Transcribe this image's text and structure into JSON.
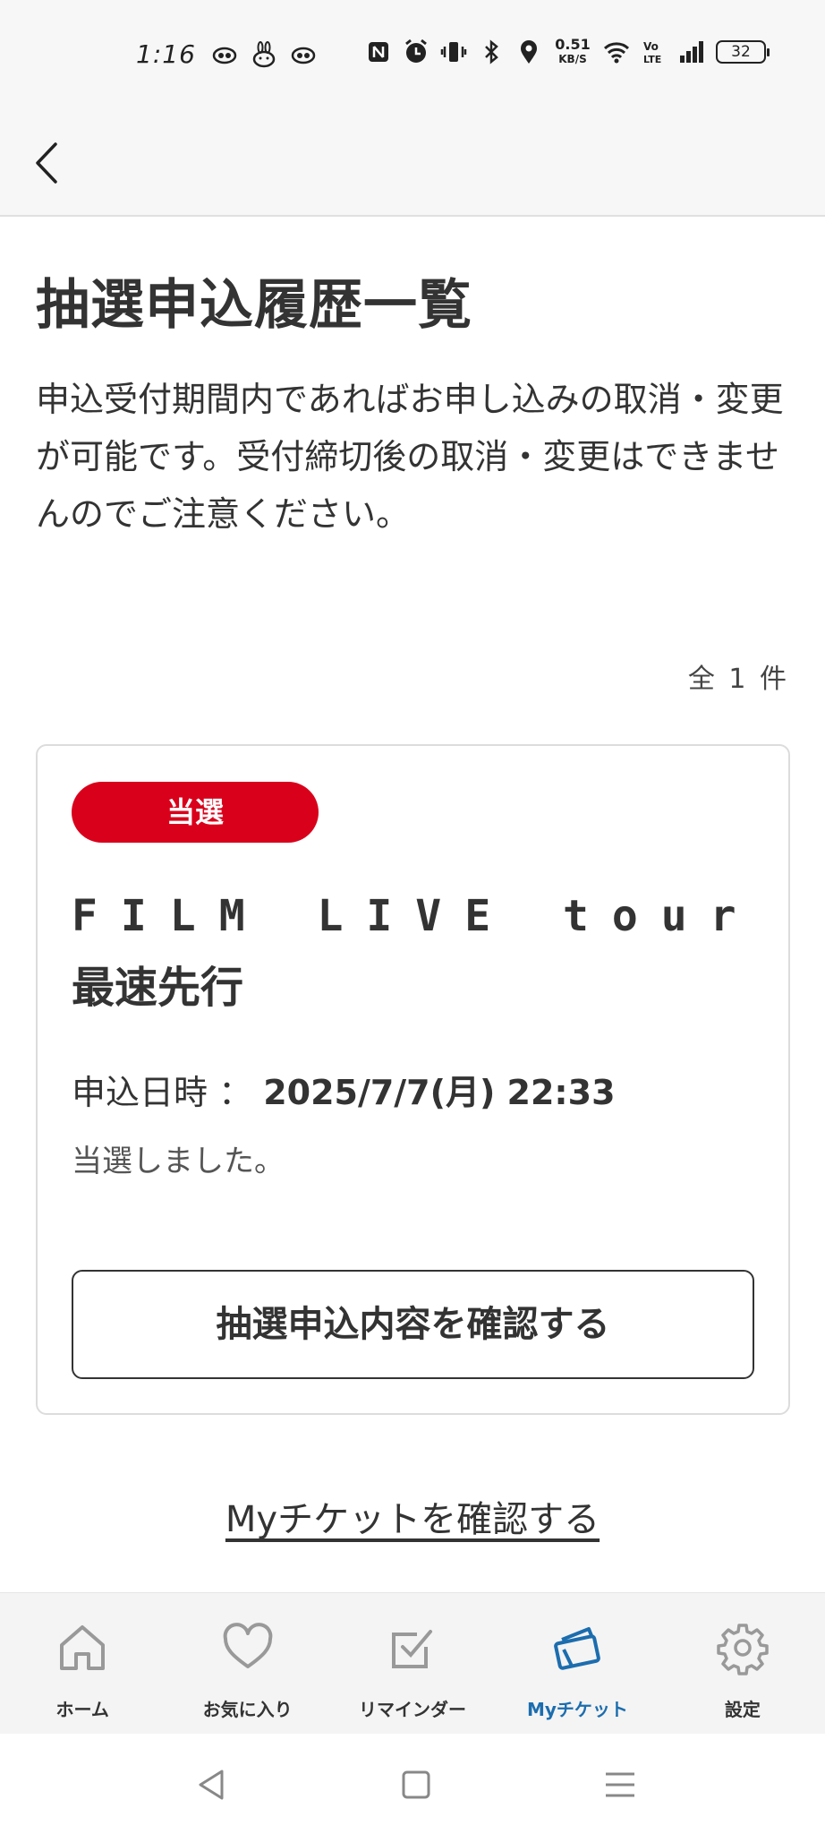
{
  "status_bar": {
    "time": "1:16",
    "network_speed_value": "0.51",
    "network_speed_unit": "KB/S",
    "battery_level": "32"
  },
  "header": {
    "back_icon": "chevron-left-icon"
  },
  "page": {
    "title": "抽選申込履歴一覧",
    "description": "申込受付期間内であればお申し込みの取消・変更が可能です。受付締切後の取消・変更はできませんのでご注意ください。",
    "result_count": "全 1 件"
  },
  "entry": {
    "status_badge": "当選",
    "status_color": "#d9001b",
    "title_latin": "FILM LIVE tour",
    "title_jp": "最速先行",
    "apply_date_label": "申込日時 ：",
    "apply_date_value": "2025/7/7(月) 22:33",
    "status_message": "当選しました。",
    "confirm_button_label": "抽選申込内容を確認する"
  },
  "my_ticket_link": "Myチケットを確認する",
  "bottom_nav": {
    "active_color": "#1c6dae",
    "items": [
      {
        "label": "ホーム",
        "icon": "home-icon"
      },
      {
        "label": "お気に入り",
        "icon": "heart-icon"
      },
      {
        "label": "リマインダー",
        "icon": "checkbox-icon"
      },
      {
        "label": "Myチケット",
        "icon": "ticket-icon"
      },
      {
        "label": "設定",
        "icon": "gear-icon"
      }
    ]
  }
}
